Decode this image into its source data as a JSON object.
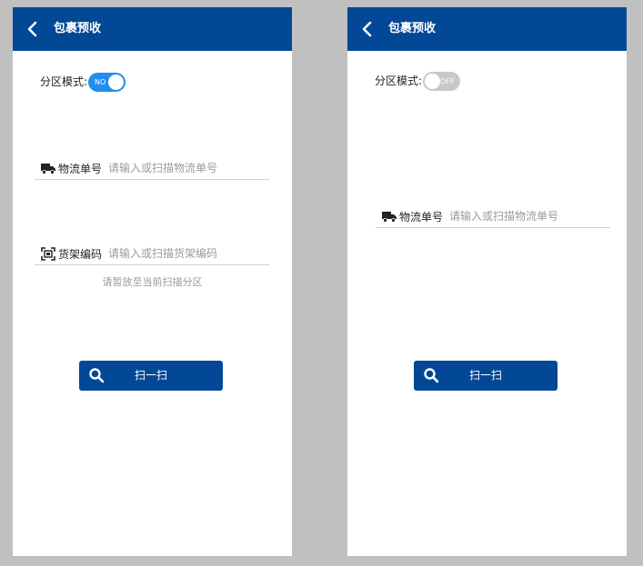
{
  "screens": [
    {
      "header": {
        "title": "包裹预收"
      },
      "mode": {
        "label": "分区模式:",
        "toggle_state": "on",
        "toggle_text": "NO"
      },
      "fields": [
        {
          "icon": "truck-icon",
          "label": "物流单号",
          "placeholder": "请输入或扫描物流单号",
          "value": ""
        },
        {
          "icon": "shelf-scan-icon",
          "label": "货架编码",
          "placeholder": "请输入或扫描货架编码",
          "value": ""
        }
      ],
      "hint": "请暂放至当前扫描分区",
      "scan_button": {
        "label": "扫一扫",
        "icon": "search-icon"
      }
    },
    {
      "header": {
        "title": "包裹预收"
      },
      "mode": {
        "label": "分区模式:",
        "toggle_state": "off",
        "toggle_text": "OFF"
      },
      "fields": [
        {
          "icon": "truck-icon",
          "label": "物流单号",
          "placeholder": "请输入或扫描物流单号",
          "value": ""
        }
      ],
      "scan_button": {
        "label": "扫一扫",
        "icon": "search-icon"
      }
    }
  ],
  "colors": {
    "primary": "#034896",
    "toggle_on": "#1f8ef1",
    "toggle_off": "#c8c8c8",
    "background": "#c0c0c0",
    "placeholder": "#9a9a9a"
  }
}
